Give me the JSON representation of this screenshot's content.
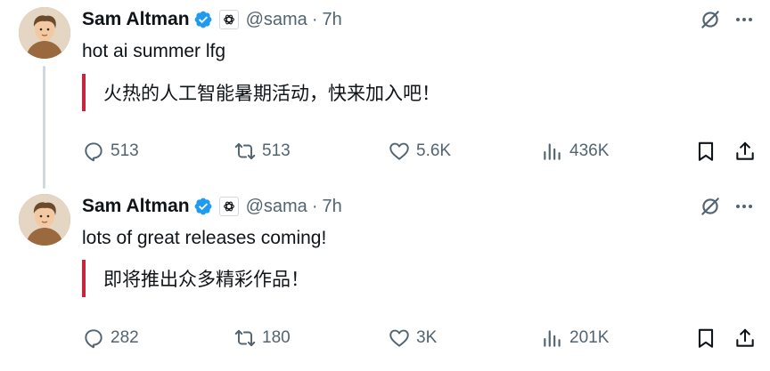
{
  "colors": {
    "verified": "#1d9bf0",
    "quote_bar": "#c8263f",
    "muted": "#536471",
    "thread_line": "#cfd9de"
  },
  "tweets": [
    {
      "author": "Sam Altman",
      "handle": "@sama",
      "separator": "·",
      "time": "7h",
      "text": "hot ai summer lfg",
      "translation": "火热的人工智能暑期活动，快来加入吧！",
      "replies": "513",
      "reposts": "513",
      "likes": "5.6K",
      "views": "436K"
    },
    {
      "author": "Sam Altman",
      "handle": "@sama",
      "separator": "·",
      "time": "7h",
      "text": "lots of great releases coming!",
      "translation": "即将推出众多精彩作品！",
      "replies": "282",
      "reposts": "180",
      "likes": "3K",
      "views": "201K"
    }
  ],
  "icons": [
    "verified-icon",
    "openai-org-icon",
    "grok-icon",
    "more-icon",
    "reply-icon",
    "repost-icon",
    "like-icon",
    "views-icon",
    "bookmark-icon",
    "share-icon"
  ]
}
